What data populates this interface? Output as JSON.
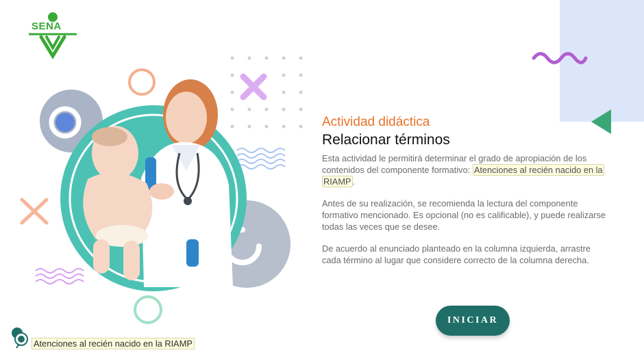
{
  "brand": {
    "logo_text": "SENA",
    "color": "#39a935"
  },
  "activity": {
    "label": "Actividad didáctica",
    "title": "Relacionar términos",
    "p1_before": "Esta actividad le permitirá determinar el grado de apropiación de los contenidos del componente formativo: ",
    "p1_highlight_a": "Atenciones al recién nacido en la",
    "p1_highlight_b": "RIAMP",
    "p1_after": ".",
    "p2": "Antes de su realización, se recomienda la lectura del componente formativo mencionado.  Es opcional (no es calificable), y puede realizarse todas las veces que se desee.",
    "p3": "De acuerdo al enunciado planteado en la columna izquierda, arrastre cada término al lugar que considere correcto de la columna derecha."
  },
  "buttons": {
    "start_label": "INICIAR"
  },
  "footer": {
    "component_name": "Atenciones al recién nacido en la  RIAMP"
  },
  "colors": {
    "accent_orange": "#e6722a",
    "button_teal": "#1f6e68",
    "hero_teal": "#4cc2b4",
    "panel_blue": "#dce6fb",
    "decor_green": "#3aa876",
    "decor_purple": "#b05fd0"
  }
}
